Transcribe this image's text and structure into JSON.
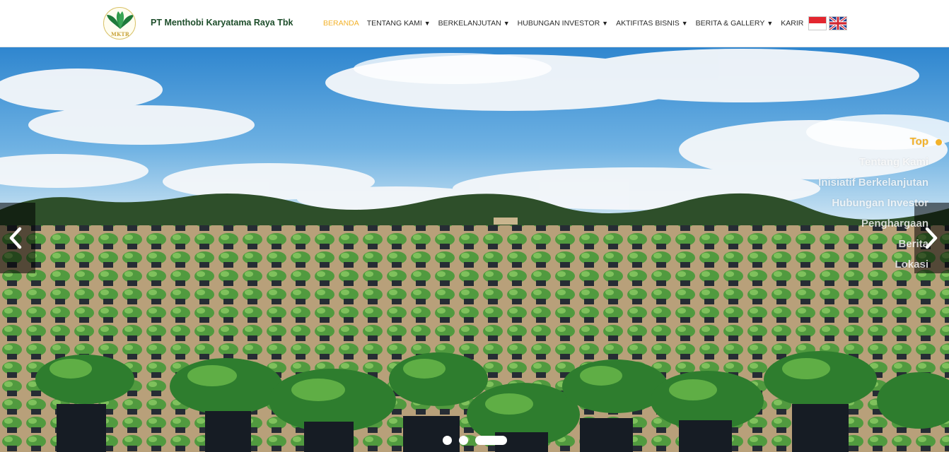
{
  "brand": {
    "company_name": "PT Menthobi Karyatama Raya Tbk",
    "logo_text": "MKTR",
    "logo_icon": "palm-leaf-logo-icon"
  },
  "nav": {
    "items": [
      {
        "label": "BERANDA",
        "has_dropdown": false,
        "active": true
      },
      {
        "label": "TENTANG KAMI",
        "has_dropdown": true
      },
      {
        "label": "BERKELANJUTAN",
        "has_dropdown": true
      },
      {
        "label": "HUBUNGAN INVESTOR",
        "has_dropdown": true
      },
      {
        "label": "AKTIFITAS BISNIS",
        "has_dropdown": true
      },
      {
        "label": "BERITA & GALLERY",
        "has_dropdown": true
      },
      {
        "label": "KARIR",
        "has_dropdown": false
      }
    ],
    "dropdown_icon": "▼",
    "flags": [
      "indonesia-flag-icon",
      "uk-flag-icon"
    ]
  },
  "hero": {
    "image_icon": "oil-palm-nursery-photo",
    "prev_icon": "chevron-left-icon",
    "next_icon": "chevron-right-icon",
    "slides_count": 3,
    "active_slide": 3
  },
  "side_nav": {
    "items": [
      "Top",
      "Tentang Kami",
      "Inisiatif Berkelanjutan",
      "Hubungan Investor",
      "Penghargaan",
      "Berita",
      "Lokasi"
    ],
    "active_index": 0
  },
  "colors": {
    "accent": "#f3b22a",
    "brand_green": "#1d4d2a",
    "nav_text": "#2d2d2d"
  }
}
